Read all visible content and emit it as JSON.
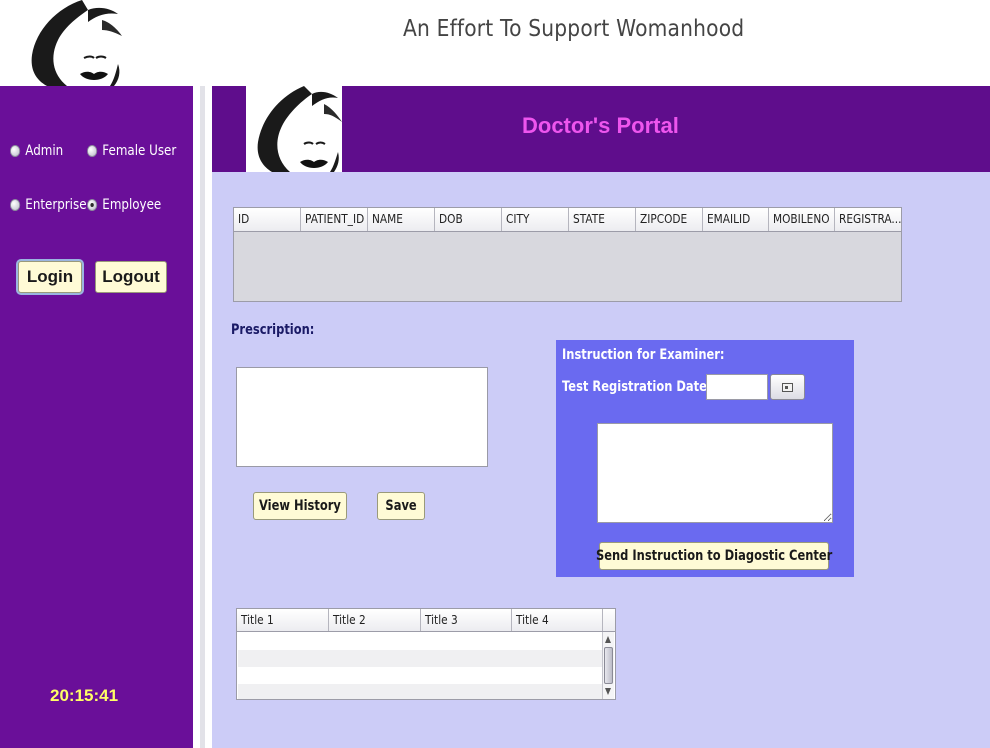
{
  "header": {
    "tagline": "An Effort To Support Womanhood",
    "logo_icon": "woman-face-silhouette-logo"
  },
  "sidebar": {
    "roles": [
      {
        "label": "Admin",
        "selected": false
      },
      {
        "label": "Female User",
        "selected": false
      },
      {
        "label": "Enterprise",
        "selected": false
      },
      {
        "label": "Employee",
        "selected": true
      }
    ],
    "login_label": "Login",
    "logout_label": "Logout",
    "clock": "20:15:41"
  },
  "portal": {
    "title": "Doctor's Portal",
    "logo_icon": "woman-face-silhouette-logo"
  },
  "patient_table": {
    "columns": [
      "ID",
      "PATIENT_ID",
      "NAME",
      "DOB",
      "CITY",
      "STATE",
      "ZIPCODE",
      "EMAILID",
      "MOBILENO",
      "REGISTRA..."
    ],
    "rows": []
  },
  "prescription": {
    "label": "Prescription:",
    "value": "",
    "view_history_label": "View History",
    "save_label": "Save"
  },
  "instruction": {
    "label": "Instruction for Examiner:",
    "test_date_label": "Test Registration Date",
    "test_date_value": "",
    "calendar_icon": "calendar-icon",
    "value": "",
    "send_label": "Send Instruction to Diagostic Center"
  },
  "bottom_table": {
    "columns": [
      "Title 1",
      "Title 2",
      "Title 3",
      "Title 4"
    ],
    "rows": []
  },
  "colors": {
    "sidebar": "#6a0f99",
    "portal_header": "#5f0d8c",
    "portal_title": "#ee55ee",
    "main_panel": "#ccccf7",
    "instruction_panel": "#6a6af0",
    "button": "#fffbd6",
    "clock": "#ffff66"
  }
}
